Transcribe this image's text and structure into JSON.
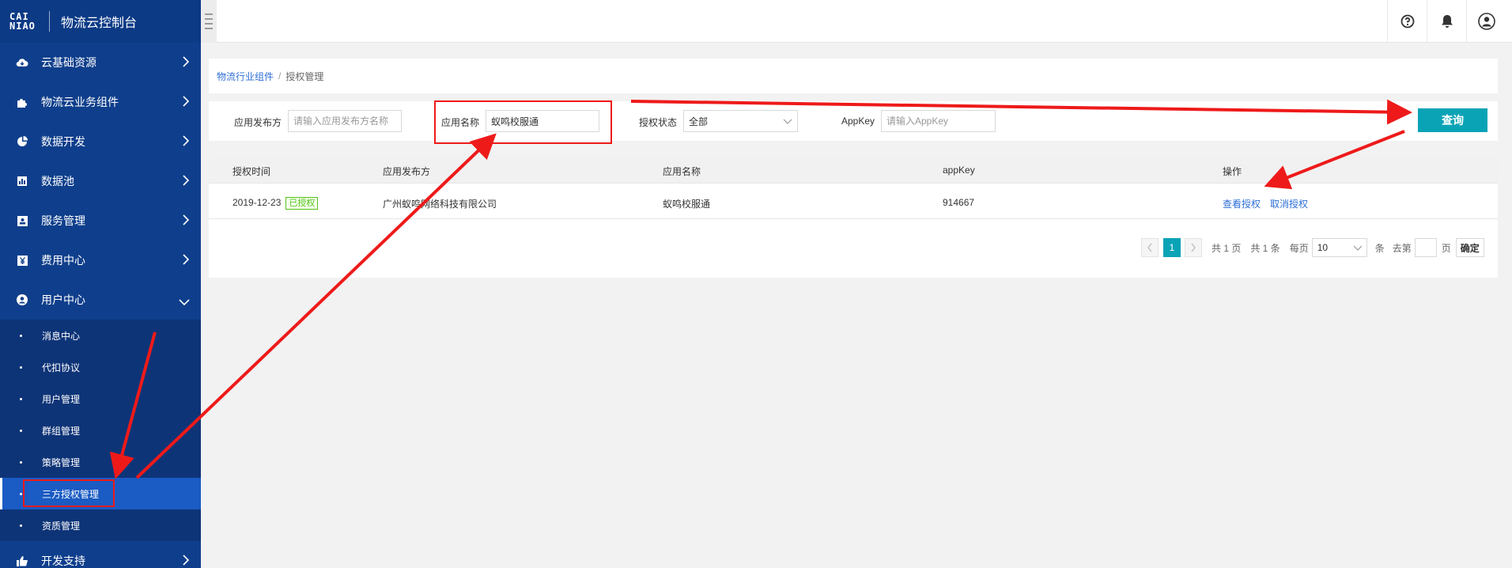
{
  "sidebar": {
    "logo_text": "CAINIAO",
    "title": "物流云控制台",
    "items": [
      {
        "label": "云基础资源",
        "icon": "cloud-icon"
      },
      {
        "label": "物流云业务组件",
        "icon": "puzzle-icon"
      },
      {
        "label": "数据开发",
        "icon": "pie-chart-icon"
      },
      {
        "label": "数据池",
        "icon": "bar-chart-icon"
      },
      {
        "label": "服务管理",
        "icon": "id-card-icon"
      },
      {
        "label": "费用中心",
        "icon": "yen-icon"
      },
      {
        "label": "用户中心",
        "icon": "user-circle-icon"
      }
    ],
    "sub_items": [
      "消息中心",
      "代扣协议",
      "用户管理",
      "群组管理",
      "策略管理",
      "三方授权管理",
      "资质管理"
    ],
    "bottom_item": {
      "label": "开发支持",
      "icon": "thumbs-up-icon"
    }
  },
  "topbar": {
    "icons": [
      "help-icon",
      "bell-icon",
      "user-avatar-icon"
    ]
  },
  "breadcrumb": {
    "parent": "物流行业组件",
    "separator": "/",
    "current": "授权管理"
  },
  "filters": {
    "publisher_label": "应用发布方",
    "publisher_placeholder": "请输入应用发布方名称",
    "app_name_label": "应用名称",
    "app_name_value": "蚁鸣校服通",
    "status_label": "授权状态",
    "status_value": "全部",
    "appkey_label": "AppKey",
    "appkey_placeholder": "请输入AppKey",
    "query_button": "查询"
  },
  "table": {
    "columns": [
      "授权时间",
      "应用发布方",
      "应用名称",
      "appKey",
      "操作"
    ],
    "rows": [
      {
        "time": "2019-12-23",
        "status_badge": "已授权",
        "publisher": "广州蚁鸣网络科技有限公司",
        "app_name": "蚁鸣校服通",
        "appkey": "914667",
        "actions": [
          "查看授权",
          "取消授权"
        ]
      }
    ]
  },
  "pagination": {
    "current_page": "1",
    "total_pages_text": "共 1 页",
    "total_items_text": "共 1 条",
    "per_page_label": "每页",
    "per_page_value": "10",
    "per_page_unit": "条",
    "goto_label": "去第",
    "goto_unit": "页",
    "confirm": "确定"
  },
  "colors": {
    "sidebar_bg": "#0f3f8c",
    "sidebar_active": "#1a5bc4",
    "accent": "#0aa3b6",
    "link": "#2e6fd6",
    "annotation": "#ee1a1a",
    "success": "#52c41a"
  }
}
